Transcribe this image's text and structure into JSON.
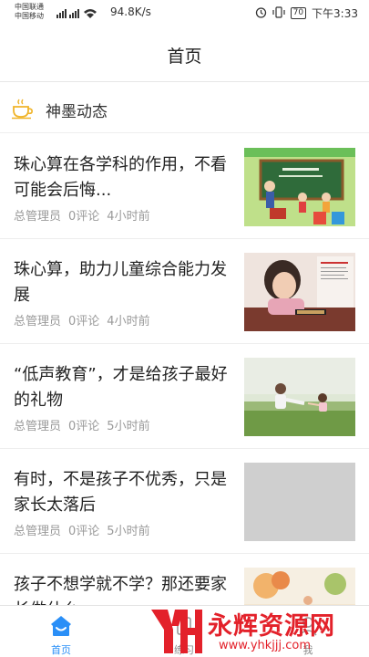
{
  "status_bar": {
    "carrier_line1": "中国联通",
    "carrier_line2": "中国移动",
    "signal": "4G",
    "net_speed": "94.8K/s",
    "battery": "70",
    "time": "下午3:33"
  },
  "header": {
    "title": "首页"
  },
  "section": {
    "title": "神墨动态",
    "icon": "cup-icon"
  },
  "news": [
    {
      "title": "珠心算在各学科的作用，不看可能会后悔...",
      "author": "总管理员",
      "comments": "0评论",
      "time": "4小时前"
    },
    {
      "title": "珠心算，助力儿童综合能力发展",
      "author": "总管理员",
      "comments": "0评论",
      "time": "4小时前"
    },
    {
      "title": "“低声教育”，才是给孩子最好的礼物",
      "author": "总管理员",
      "comments": "0评论",
      "time": "5小时前"
    },
    {
      "title": "有时，不是孩子不优秀，只是家长太落后",
      "author": "总管理员",
      "comments": "0评论",
      "time": "5小时前"
    },
    {
      "title": "孩子不想学就不学？那还要家长做什么",
      "author": "",
      "comments": "",
      "time": ""
    }
  ],
  "tabs": [
    {
      "label": "首页",
      "icon": "home-icon",
      "active": true
    },
    {
      "label": "练习",
      "icon": "practice-icon",
      "active": false
    },
    {
      "label": "我",
      "icon": "profile-icon",
      "active": false
    }
  ],
  "watermark": {
    "text": "永辉资源网",
    "url": "www.yhkjjj.com"
  },
  "colors": {
    "accent": "#2a8ff7",
    "watermark": "#e3212a",
    "cup": "#f0b429"
  }
}
